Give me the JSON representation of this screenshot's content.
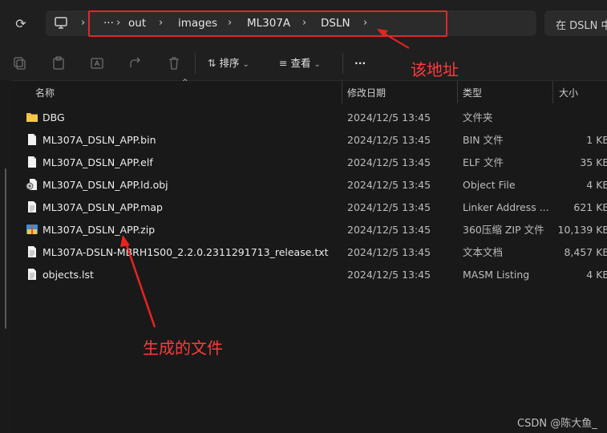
{
  "address_bar": {
    "overflow": "···",
    "crumbs": [
      "out",
      "images",
      "ML307A",
      "DSLN"
    ],
    "search_placeholder": "在 DSLN 中"
  },
  "toolbar": {
    "sort_label": "排序",
    "view_label": "查看",
    "more": "···"
  },
  "columns": {
    "name": "名称",
    "modified": "修改日期",
    "type": "类型",
    "size": "大小"
  },
  "files": [
    {
      "icon": "folder-icon",
      "name": "DBG",
      "modified": "2024/12/5 13:45",
      "type": "文件夹",
      "size": ""
    },
    {
      "icon": "file-icon",
      "name": "ML307A_DSLN_APP.bin",
      "modified": "2024/12/5 13:45",
      "type": "BIN 文件",
      "size": "1 KB"
    },
    {
      "icon": "file-icon",
      "name": "ML307A_DSLN_APP.elf",
      "modified": "2024/12/5 13:45",
      "type": "ELF 文件",
      "size": "35 KB"
    },
    {
      "icon": "object-file-icon",
      "name": "ML307A_DSLN_APP.ld.obj",
      "modified": "2024/12/5 13:45",
      "type": "Object File",
      "size": "4 KB"
    },
    {
      "icon": "text-file-icon",
      "name": "ML307A_DSLN_APP.map",
      "modified": "2024/12/5 13:45",
      "type": "Linker Address ...",
      "size": "621 KB"
    },
    {
      "icon": "zip-archive-icon",
      "name": "ML307A_DSLN_APP.zip",
      "modified": "2024/12/5 13:45",
      "type": "360压缩 ZIP 文件",
      "size": "10,139 KB"
    },
    {
      "icon": "text-file-icon",
      "name": "ML307A-DSLN-MBRH1S00_2.2.0.2311291713_release.txt",
      "modified": "2024/12/5 13:45",
      "type": "文本文档",
      "size": "8,457 KB"
    },
    {
      "icon": "text-file-icon",
      "name": "objects.lst",
      "modified": "2024/12/5 13:45",
      "type": "MASM Listing",
      "size": "4 KB"
    }
  ],
  "annotations": {
    "address_note": "该地址",
    "output_note": "生成的文件",
    "accent_color": "#ff3b3b"
  },
  "watermark": "CSDN @陈大鱼_"
}
